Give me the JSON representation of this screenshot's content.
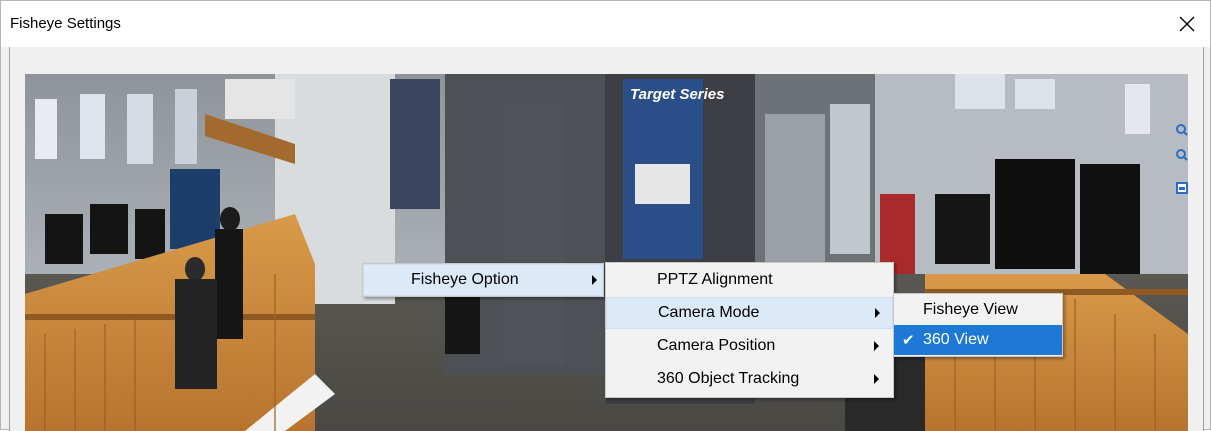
{
  "window": {
    "title": "Fisheye Settings"
  },
  "menus": {
    "level1": {
      "items": [
        {
          "label": "Fisheye Option",
          "has_submenu": true
        }
      ]
    },
    "level2": {
      "items": [
        {
          "label": "PPTZ Alignment",
          "has_submenu": false
        },
        {
          "label": "Camera Mode",
          "has_submenu": true
        },
        {
          "label": "Camera Position",
          "has_submenu": true
        },
        {
          "label": "360 Object Tracking",
          "has_submenu": true
        }
      ]
    },
    "level3": {
      "items": [
        {
          "label": "Fisheye View",
          "checked": false
        },
        {
          "label": "360 View",
          "checked": true
        }
      ]
    }
  },
  "video": {
    "poster_text": "Target Series"
  },
  "colors": {
    "menu_highlight": "#1e78d6",
    "menu_hover": "#dce9f7"
  }
}
